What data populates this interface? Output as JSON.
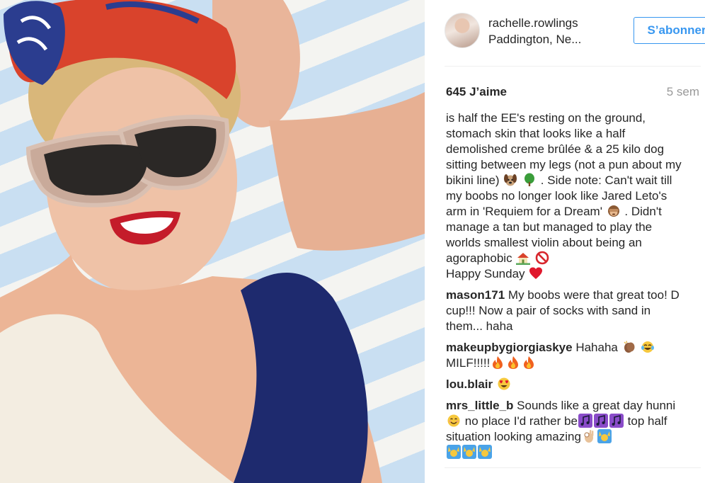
{
  "post": {
    "username": "rachelle.rowlings",
    "location": "Paddington, Ne...",
    "follow_label": "S’abonner",
    "likes": "645 J’aime",
    "age": "5 sem"
  },
  "caption": {
    "text_1": "is half the EE's resting on the ground, stomach skin that looks like a half demolished creme brûlée & a 25 kilo dog sitting between my legs (not a pun about my bikini line)",
    "text_2": ". Side note: Can't wait till my boobs no longer look like Jared Leto's arm in 'Requiem for a Dream'",
    "text_3": ". Didn't manage a tan but managed to play the worlds smallest violin about being an agoraphobic",
    "text_4": "Happy Sunday"
  },
  "comments": {
    "c1_author": "mason171",
    "c1_text": "My boobs were that great too! D cup!!! Now a pair of socks with sand in them... haha",
    "c2_author": "makeupbygiorgiaskye",
    "c2_text": "Hahaha",
    "c2_text_b": "MILF!!!!!",
    "c3_author": "lou.blair",
    "c4_author": "mrs_little_b",
    "c4_text_a": "Sounds like a great day hunni",
    "c4_text_b": "no place I'd rather be",
    "c4_text_c": "top half situation looking amazing"
  },
  "icons": {
    "dog": "dog-face-icon",
    "tree": "tree-icon",
    "monkey": "see-no-evil-monkey-icon",
    "house": "house-icon",
    "no": "no-entry-icon",
    "heart": "red-heart-icon",
    "clap": "clapping-hands-icon",
    "tears": "tears-of-joy-icon",
    "fire": "fire-icon",
    "heart_eyes": "heart-eyes-icon",
    "blush": "smiling-face-icon",
    "music": "musical-notes-icon",
    "ok_hand": "ok-hand-icon",
    "raised_hands": "raising-hands-icon"
  },
  "colors": {
    "accent": "#3897f0",
    "text": "#262626",
    "muted": "#999999"
  }
}
